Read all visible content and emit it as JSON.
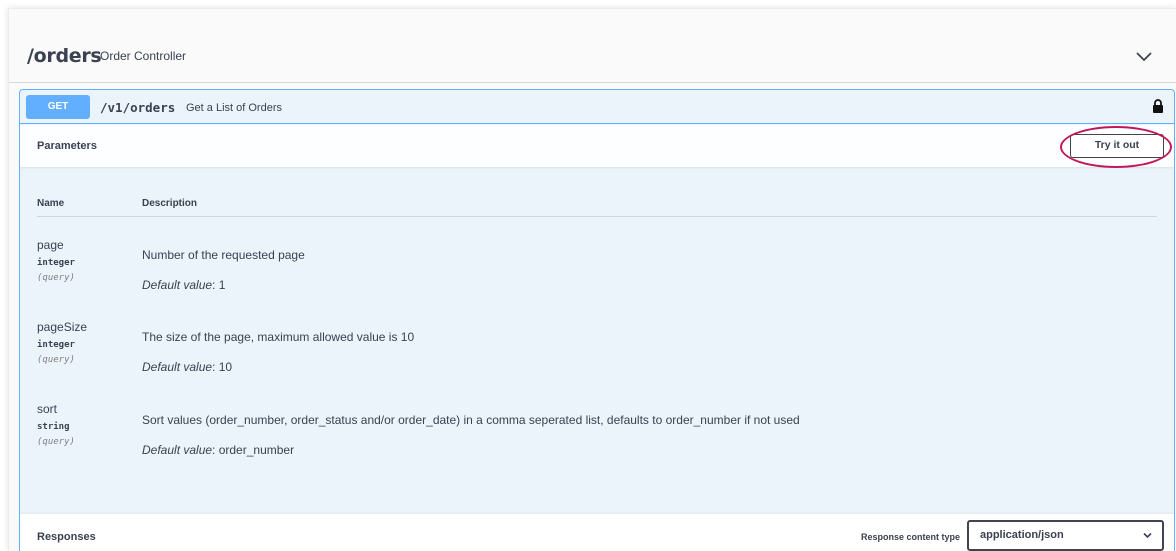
{
  "tag": {
    "name": "/orders",
    "description": "Order Controller",
    "chevron_icon": "chevron-down-icon"
  },
  "operation": {
    "method": "GET",
    "path": "/v1/orders",
    "summary": "Get a List of Orders",
    "lock_icon": "lock-icon",
    "method_color": "#61affe",
    "block_bg": "#ebf3fb"
  },
  "parameters": {
    "title": "Parameters",
    "try_label": "Try it out",
    "highlight_color": "#c2185b",
    "columns": {
      "name": "Name",
      "description": "Description"
    },
    "default_label": "Default value",
    "items": [
      {
        "name": "page",
        "type": "integer",
        "in": "(query)",
        "description": "Number of the requested page",
        "default_value": ": 1"
      },
      {
        "name": "pageSize",
        "type": "integer",
        "in": "(query)",
        "description": "The size of the page, maximum allowed value is 10",
        "default_value": ": 10"
      },
      {
        "name": "sort",
        "type": "string",
        "in": "(query)",
        "description": "Sort values (order_number, order_status and/or order_date) in a comma seperated list, defaults to order_number if not used",
        "default_value": ": order_number"
      }
    ]
  },
  "responses": {
    "title": "Responses",
    "content_type_label": "Response content type",
    "content_type_value": "application/json"
  }
}
